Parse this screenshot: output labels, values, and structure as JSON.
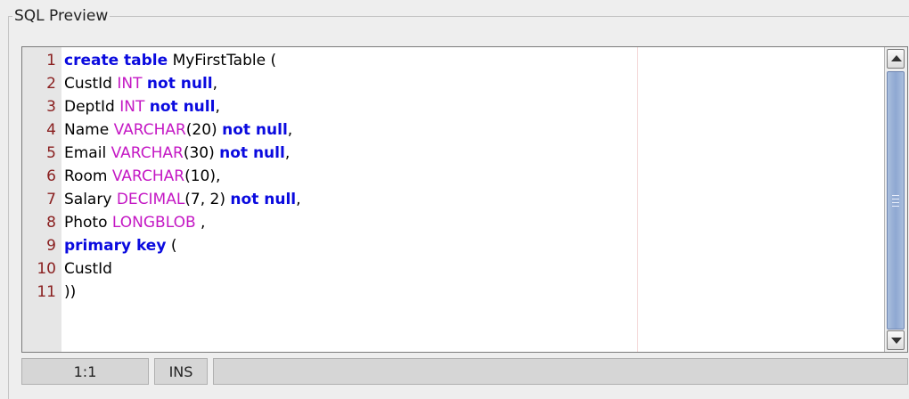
{
  "panel": {
    "title": "SQL Preview"
  },
  "editor": {
    "lines": [
      {
        "num": "1",
        "segments": [
          {
            "text": "create table",
            "kind": "kw"
          },
          {
            "text": " MyFirstTable (",
            "kind": "plain"
          }
        ]
      },
      {
        "num": "2",
        "segments": [
          {
            "text": "CustId ",
            "kind": "plain"
          },
          {
            "text": "INT",
            "kind": "ty"
          },
          {
            "text": " ",
            "kind": "plain"
          },
          {
            "text": "not null",
            "kind": "kw"
          },
          {
            "text": ",",
            "kind": "plain"
          }
        ]
      },
      {
        "num": "3",
        "segments": [
          {
            "text": "DeptId ",
            "kind": "plain"
          },
          {
            "text": "INT",
            "kind": "ty"
          },
          {
            "text": " ",
            "kind": "plain"
          },
          {
            "text": "not null",
            "kind": "kw"
          },
          {
            "text": ",",
            "kind": "plain"
          }
        ]
      },
      {
        "num": "4",
        "segments": [
          {
            "text": "Name ",
            "kind": "plain"
          },
          {
            "text": "VARCHAR",
            "kind": "ty"
          },
          {
            "text": "(20) ",
            "kind": "plain"
          },
          {
            "text": "not null",
            "kind": "kw"
          },
          {
            "text": ",",
            "kind": "plain"
          }
        ]
      },
      {
        "num": "5",
        "segments": [
          {
            "text": "Email ",
            "kind": "plain"
          },
          {
            "text": "VARCHAR",
            "kind": "ty"
          },
          {
            "text": "(30) ",
            "kind": "plain"
          },
          {
            "text": "not null",
            "kind": "kw"
          },
          {
            "text": ",",
            "kind": "plain"
          }
        ]
      },
      {
        "num": "6",
        "segments": [
          {
            "text": "Room ",
            "kind": "plain"
          },
          {
            "text": "VARCHAR",
            "kind": "ty"
          },
          {
            "text": "(10),",
            "kind": "plain"
          }
        ]
      },
      {
        "num": "7",
        "segments": [
          {
            "text": "Salary ",
            "kind": "plain"
          },
          {
            "text": "DECIMAL",
            "kind": "ty"
          },
          {
            "text": "(7, 2) ",
            "kind": "plain"
          },
          {
            "text": "not null",
            "kind": "kw"
          },
          {
            "text": ",",
            "kind": "plain"
          }
        ]
      },
      {
        "num": "8",
        "segments": [
          {
            "text": "Photo ",
            "kind": "plain"
          },
          {
            "text": "LONGBLOB",
            "kind": "ty"
          },
          {
            "text": " ,",
            "kind": "plain"
          }
        ]
      },
      {
        "num": "9",
        "segments": [
          {
            "text": "primary key",
            "kind": "kw"
          },
          {
            "text": " (",
            "kind": "plain"
          }
        ]
      },
      {
        "num": "10",
        "segments": [
          {
            "text": "CustId",
            "kind": "plain"
          }
        ]
      },
      {
        "num": "11",
        "segments": [
          {
            "text": "))",
            "kind": "plain"
          }
        ]
      }
    ]
  },
  "statusbar": {
    "position": "1:1",
    "mode": "INS",
    "extra": ""
  },
  "colors": {
    "keyword": "#0a0adf",
    "type": "#c418c4",
    "line_number": "#8a2020",
    "thumb": "#8fa8d2"
  },
  "icons": {
    "scroll_up": "triangle-up-icon",
    "scroll_down": "triangle-down-icon"
  }
}
